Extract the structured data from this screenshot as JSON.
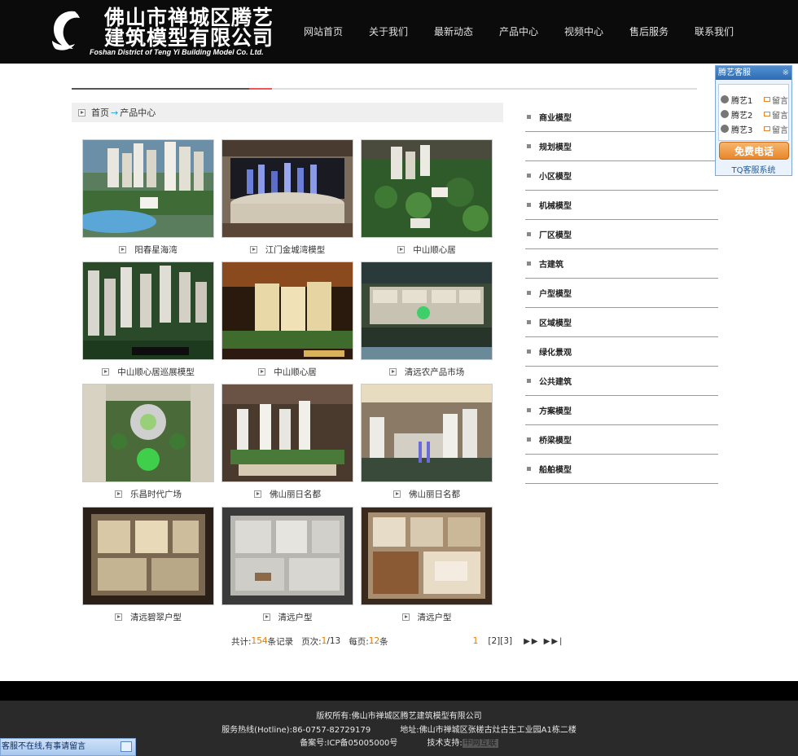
{
  "header": {
    "logo_cn_line1": "佛山市禅城区腾艺",
    "logo_cn_line2": "建筑模型有限公司",
    "logo_en": "Foshan District of Teng Yi Building Model Co. Ltd.",
    "nav": [
      "网站首页",
      "关于我们",
      "最新动态",
      "产品中心",
      "视频中心",
      "售后服务",
      "联系我们"
    ]
  },
  "breadcrumb": {
    "home": "首页",
    "sep": "→",
    "current": "产品中心"
  },
  "products": [
    {
      "title": "阳春星海湾",
      "scene": "towers-water"
    },
    {
      "title": "江门金城湾模型",
      "scene": "showroom"
    },
    {
      "title": "中山顺心居",
      "scene": "greenery"
    },
    {
      "title": "中山顺心居巡展模型",
      "scene": "towers-night"
    },
    {
      "title": "中山顺心居",
      "scene": "lit-building"
    },
    {
      "title": "清远农产品市场",
      "scene": "market"
    },
    {
      "title": "乐昌时代广场",
      "scene": "plaza"
    },
    {
      "title": "佛山丽日名都",
      "scene": "towers-mall"
    },
    {
      "title": "佛山丽日名都",
      "scene": "exhibit-hall"
    },
    {
      "title": "清远碧翠户型",
      "scene": "interior-warm"
    },
    {
      "title": "清远户型",
      "scene": "interior-grey"
    },
    {
      "title": "清远户型",
      "scene": "interior-wood"
    }
  ],
  "pager": {
    "total_label": "共计:",
    "total": "154",
    "total_suffix": "条记录",
    "page_label": "页次:",
    "page_current": "1",
    "page_total": "/13",
    "per_label": "每页:",
    "per": "12",
    "per_suffix": "条",
    "current": "1",
    "links": "[2][3]",
    "arrows": "▶▶ ▶▶|"
  },
  "categories": [
    "商业模型",
    "规划模型",
    "小区模型",
    "机械模型",
    "厂区模型",
    "古建筑",
    "户型模型",
    "区域模型",
    "绿化景观",
    "公共建筑",
    "方案模型",
    "桥梁模型",
    "船舶模型"
  ],
  "service": {
    "title": "腾艺客服",
    "close": "※",
    "agents": [
      {
        "name": "腾艺1",
        "msg": "留言"
      },
      {
        "name": "腾艺2",
        "msg": "留言"
      },
      {
        "name": "腾艺3",
        "msg": "留言"
      }
    ],
    "call": "免费电话",
    "footer": "TQ客服系统"
  },
  "footer": {
    "copyright": "版权所有:佛山市禅城区腾艺建筑模型有限公司",
    "hotline": "服务热线(Hotline):86-0757-82729179",
    "address": "地址:佛山市禅城区张槎古灶古生工业园A1栋二楼",
    "icp": "备案号:ICP备05005000号",
    "tech_label": "技术支持:",
    "tech": "中网互联"
  },
  "chatbar": {
    "text": "客服不在线,有事请留言"
  },
  "colors": {
    "accent": "#e07a00",
    "header_bg": "#0b0b0b",
    "footer_bg": "#2a2a2a",
    "link_blue": "#2aa1d8"
  }
}
